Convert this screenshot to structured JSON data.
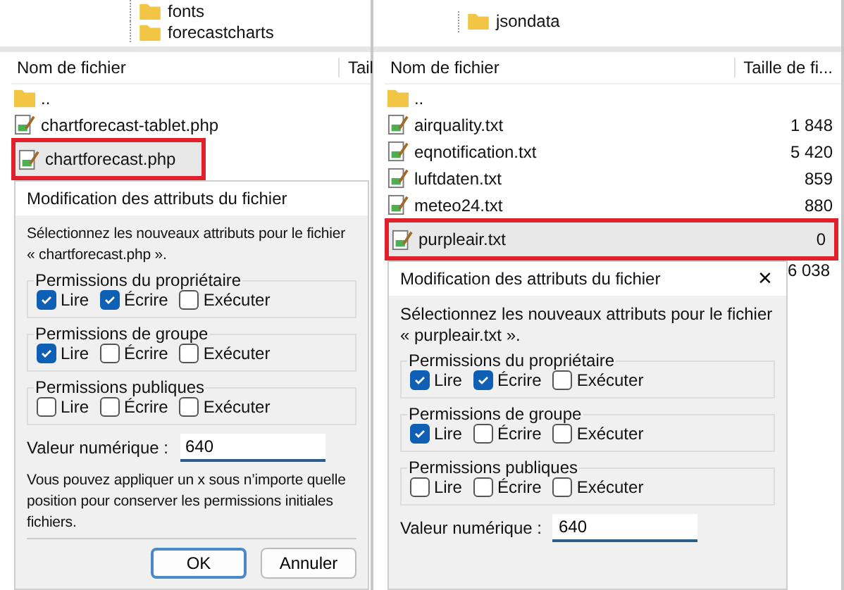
{
  "panels": [
    {
      "tree": [
        "fonts",
        "forecastcharts"
      ],
      "columns": [
        "Nom de fichier",
        "Tail"
      ],
      "rows": [
        {
          "kind": "folder",
          "name": "..",
          "highlighted": false
        },
        {
          "kind": "file",
          "name": "chartforecast-tablet.php",
          "highlighted": false
        },
        {
          "kind": "file",
          "name": "chartforecast.php",
          "highlighted": true
        }
      ],
      "dialog": {
        "title": "Modification des attributs du fichier",
        "message": [
          "Sélectionnez les nouveaux attributs pour le fichier",
          "« chartforecast.php »."
        ],
        "groups": [
          {
            "title": "Permissions du propriétaire",
            "options": [
              {
                "label": "Lire",
                "checked": true
              },
              {
                "label": "Écrire",
                "checked": true
              },
              {
                "label": "Exécuter",
                "checked": false
              }
            ]
          },
          {
            "title": "Permissions de groupe",
            "options": [
              {
                "label": "Lire",
                "checked": true
              },
              {
                "label": "Écrire",
                "checked": false
              },
              {
                "label": "Exécuter",
                "checked": false
              }
            ]
          },
          {
            "title": "Permissions publiques",
            "options": [
              {
                "label": "Lire",
                "checked": false
              },
              {
                "label": "Écrire",
                "checked": false
              },
              {
                "label": "Exécuter",
                "checked": false
              }
            ]
          }
        ],
        "numeric_label": "Valeur numérique :",
        "numeric_value": "640",
        "note": [
          "Vous pouvez appliquer un x sous n’importe quelle",
          "position pour conserver les permissions initiales",
          "fichiers."
        ],
        "buttons": [
          {
            "label": "OK",
            "default": true
          },
          {
            "label": "Annuler",
            "default": false
          }
        ]
      }
    },
    {
      "tree": [
        "jsondata"
      ],
      "columns": [
        "Nom de fichier",
        "Taille de fi..."
      ],
      "rows": [
        {
          "kind": "folder",
          "name": "..",
          "highlighted": false
        },
        {
          "kind": "file",
          "name": "airquality.txt",
          "size": "1 848",
          "highlighted": false
        },
        {
          "kind": "file",
          "name": "eqnotification.txt",
          "size": "5 420",
          "highlighted": false
        },
        {
          "kind": "file",
          "name": "luftdaten.txt",
          "size": "859",
          "highlighted": false
        },
        {
          "kind": "file",
          "name": "meteo24.txt",
          "size": "880",
          "highlighted": false
        },
        {
          "kind": "file",
          "name": "purpleair.txt",
          "size": "0",
          "highlighted": true
        }
      ],
      "trailing_sizes": [
        "6 038"
      ],
      "dialog": {
        "title": "Modification des attributs du fichier",
        "close": "×",
        "message": [
          "Sélectionnez les nouveaux attributs pour le fichier",
          "« purpleair.txt »."
        ],
        "groups": [
          {
            "title": "Permissions du propriétaire",
            "options": [
              {
                "label": "Lire",
                "checked": true
              },
              {
                "label": "Écrire",
                "checked": true
              },
              {
                "label": "Exécuter",
                "checked": false
              }
            ]
          },
          {
            "title": "Permissions de groupe",
            "options": [
              {
                "label": "Lire",
                "checked": true
              },
              {
                "label": "Écrire",
                "checked": false
              },
              {
                "label": "Exécuter",
                "checked": false
              }
            ]
          },
          {
            "title": "Permissions publiques",
            "options": [
              {
                "label": "Lire",
                "checked": false
              },
              {
                "label": "Écrire",
                "checked": false
              },
              {
                "label": "Exécuter",
                "checked": false
              }
            ]
          }
        ],
        "numeric_label": "Valeur numérique :",
        "numeric_value": "640"
      }
    }
  ]
}
